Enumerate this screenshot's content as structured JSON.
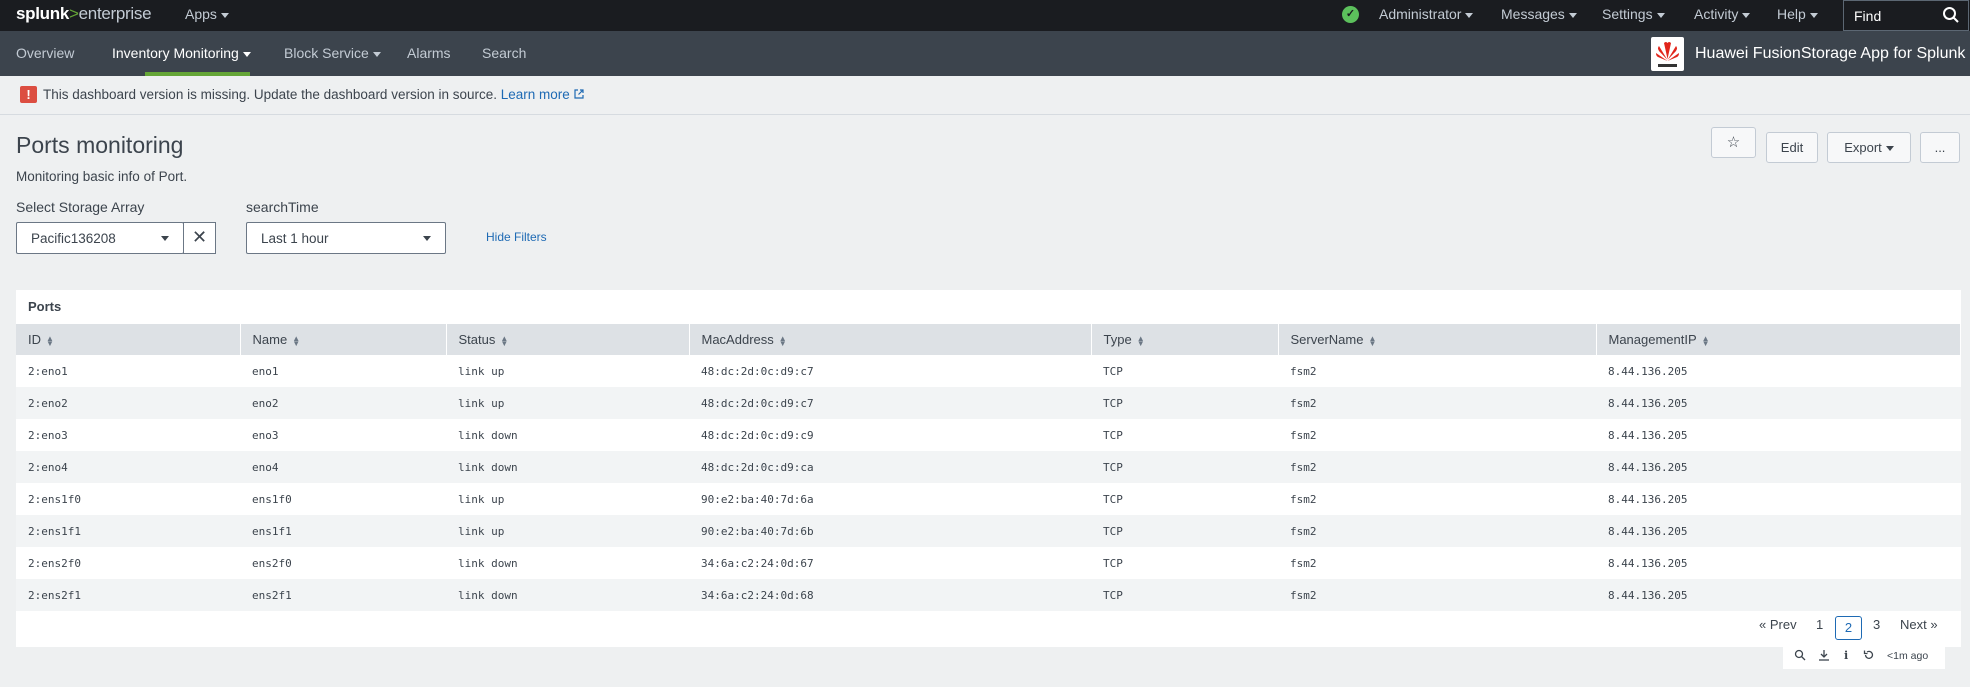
{
  "topbar": {
    "brand": [
      "splunk",
      ">",
      "enterprise"
    ],
    "apps_label": "Apps",
    "menu": [
      "Administrator",
      "Messages",
      "Settings",
      "Activity",
      "Help"
    ],
    "find_placeholder": "Find"
  },
  "appbar": {
    "nav": [
      "Overview",
      "Inventory Monitoring",
      "Block Service",
      "Alarms",
      "Search"
    ],
    "app_title": "Huawei FusionStorage App for Splunk"
  },
  "warning": {
    "text": "This dashboard version is missing. Update the dashboard version in source.",
    "link": "Learn more"
  },
  "page": {
    "title": "Ports monitoring",
    "description": "Monitoring basic info of Port.",
    "edit_label": "Edit",
    "export_label": "Export",
    "more_label": "..."
  },
  "filters": {
    "array_label": "Select Storage Array",
    "array_value": "Pacific136208",
    "time_label": "searchTime",
    "time_value": "Last 1 hour",
    "hide_label": "Hide Filters"
  },
  "panel": {
    "title": "Ports",
    "columns": [
      "ID",
      "Name",
      "Status",
      "MacAddress",
      "Type",
      "ServerName",
      "ManagementIP"
    ],
    "rows": [
      [
        "2:eno1",
        "eno1",
        "link up",
        "48:dc:2d:0c:d9:c7",
        "TCP",
        "fsm2",
        "8.44.136.205"
      ],
      [
        "2:eno2",
        "eno2",
        "link up",
        "48:dc:2d:0c:d9:c7",
        "TCP",
        "fsm2",
        "8.44.136.205"
      ],
      [
        "2:eno3",
        "eno3",
        "link down",
        "48:dc:2d:0c:d9:c9",
        "TCP",
        "fsm2",
        "8.44.136.205"
      ],
      [
        "2:eno4",
        "eno4",
        "link down",
        "48:dc:2d:0c:d9:ca",
        "TCP",
        "fsm2",
        "8.44.136.205"
      ],
      [
        "2:ens1f0",
        "ens1f0",
        "link up",
        "90:e2:ba:40:7d:6a",
        "TCP",
        "fsm2",
        "8.44.136.205"
      ],
      [
        "2:ens1f1",
        "ens1f1",
        "link up",
        "90:e2:ba:40:7d:6b",
        "TCP",
        "fsm2",
        "8.44.136.205"
      ],
      [
        "2:ens2f0",
        "ens2f0",
        "link down",
        "34:6a:c2:24:0d:67",
        "TCP",
        "fsm2",
        "8.44.136.205"
      ],
      [
        "2:ens2f1",
        "ens2f1",
        "link down",
        "34:6a:c2:24:0d:68",
        "TCP",
        "fsm2",
        "8.44.136.205"
      ]
    ],
    "pagination": {
      "prev": "« Prev",
      "pages": [
        "1",
        "2",
        "3"
      ],
      "current": "2",
      "next": "Next »"
    },
    "last_updated": "<1m ago"
  },
  "colors": {
    "topbar_bg": "#1a1c20",
    "appbar_bg": "#3c444d",
    "accent_green": "#65a637",
    "link_blue": "#1e6ab4",
    "error_red": "#dc4e41"
  }
}
